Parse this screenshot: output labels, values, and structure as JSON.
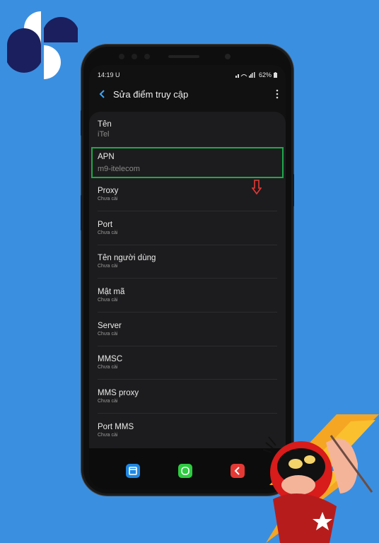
{
  "status": {
    "time": "14:19",
    "carrier_icon": "U",
    "battery": "62%"
  },
  "appbar": {
    "title": "Sửa điểm truy cập"
  },
  "fields": [
    {
      "label": "Tên",
      "value": "iTel"
    },
    {
      "label": "APN",
      "value": "m9-itelecom"
    },
    {
      "label": "Proxy",
      "value": "Chưa cài"
    },
    {
      "label": "Port",
      "value": "Chưa cài"
    },
    {
      "label": "Tên người dùng",
      "value": "Chưa cài"
    },
    {
      "label": "Mật mã",
      "value": "Chưa cài"
    },
    {
      "label": "Server",
      "value": "Chưa cài"
    },
    {
      "label": "MMSC",
      "value": "Chưa cài"
    },
    {
      "label": "MMS proxy",
      "value": "Chưa cài"
    },
    {
      "label": "Port MMS",
      "value": "Chưa cài"
    }
  ],
  "colors": {
    "background": "#3b8fe0",
    "highlight": "#1fa84a",
    "arrow": "#e53935",
    "nav_recent": "#1e88e5",
    "nav_home": "#2ecc40",
    "nav_back": "#e53935"
  },
  "icons": [
    "logo-icon",
    "back-arrow-icon",
    "kebab-menu-icon",
    "red-down-arrow-icon",
    "recent-apps-icon",
    "home-icon",
    "back-icon"
  ]
}
